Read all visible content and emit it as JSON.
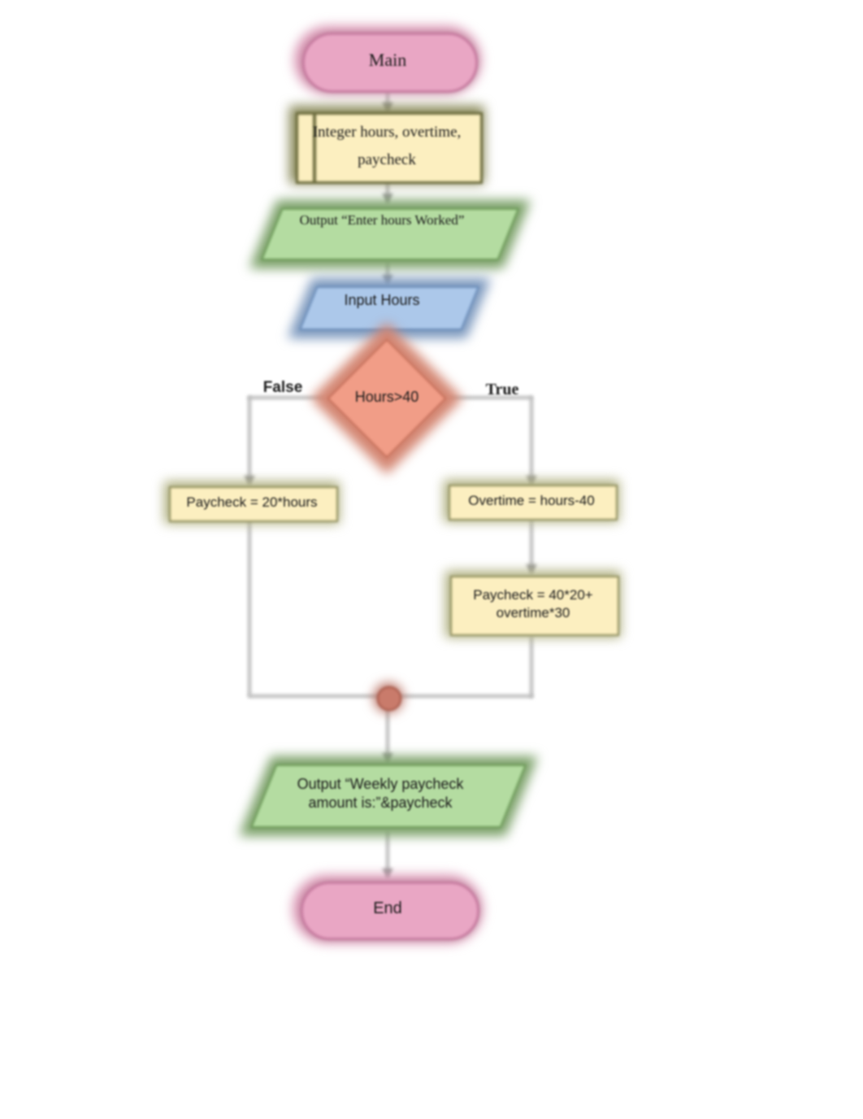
{
  "nodes": {
    "start": "Main",
    "declare": "Integer hours, overtime, paycheck",
    "output1": "Output “Enter hours Worked”",
    "input": "Input Hours",
    "decision": "Hours>40",
    "false_branch": "Paycheck = 20*hours",
    "true_branch1": "Overtime = hours-40",
    "true_branch2": "Paycheck = 40*20+ overtime*30",
    "output2": "Output “Weekly paycheck amount is:”&paycheck",
    "end": "End"
  },
  "labels": {
    "false": "False",
    "true": "True"
  }
}
